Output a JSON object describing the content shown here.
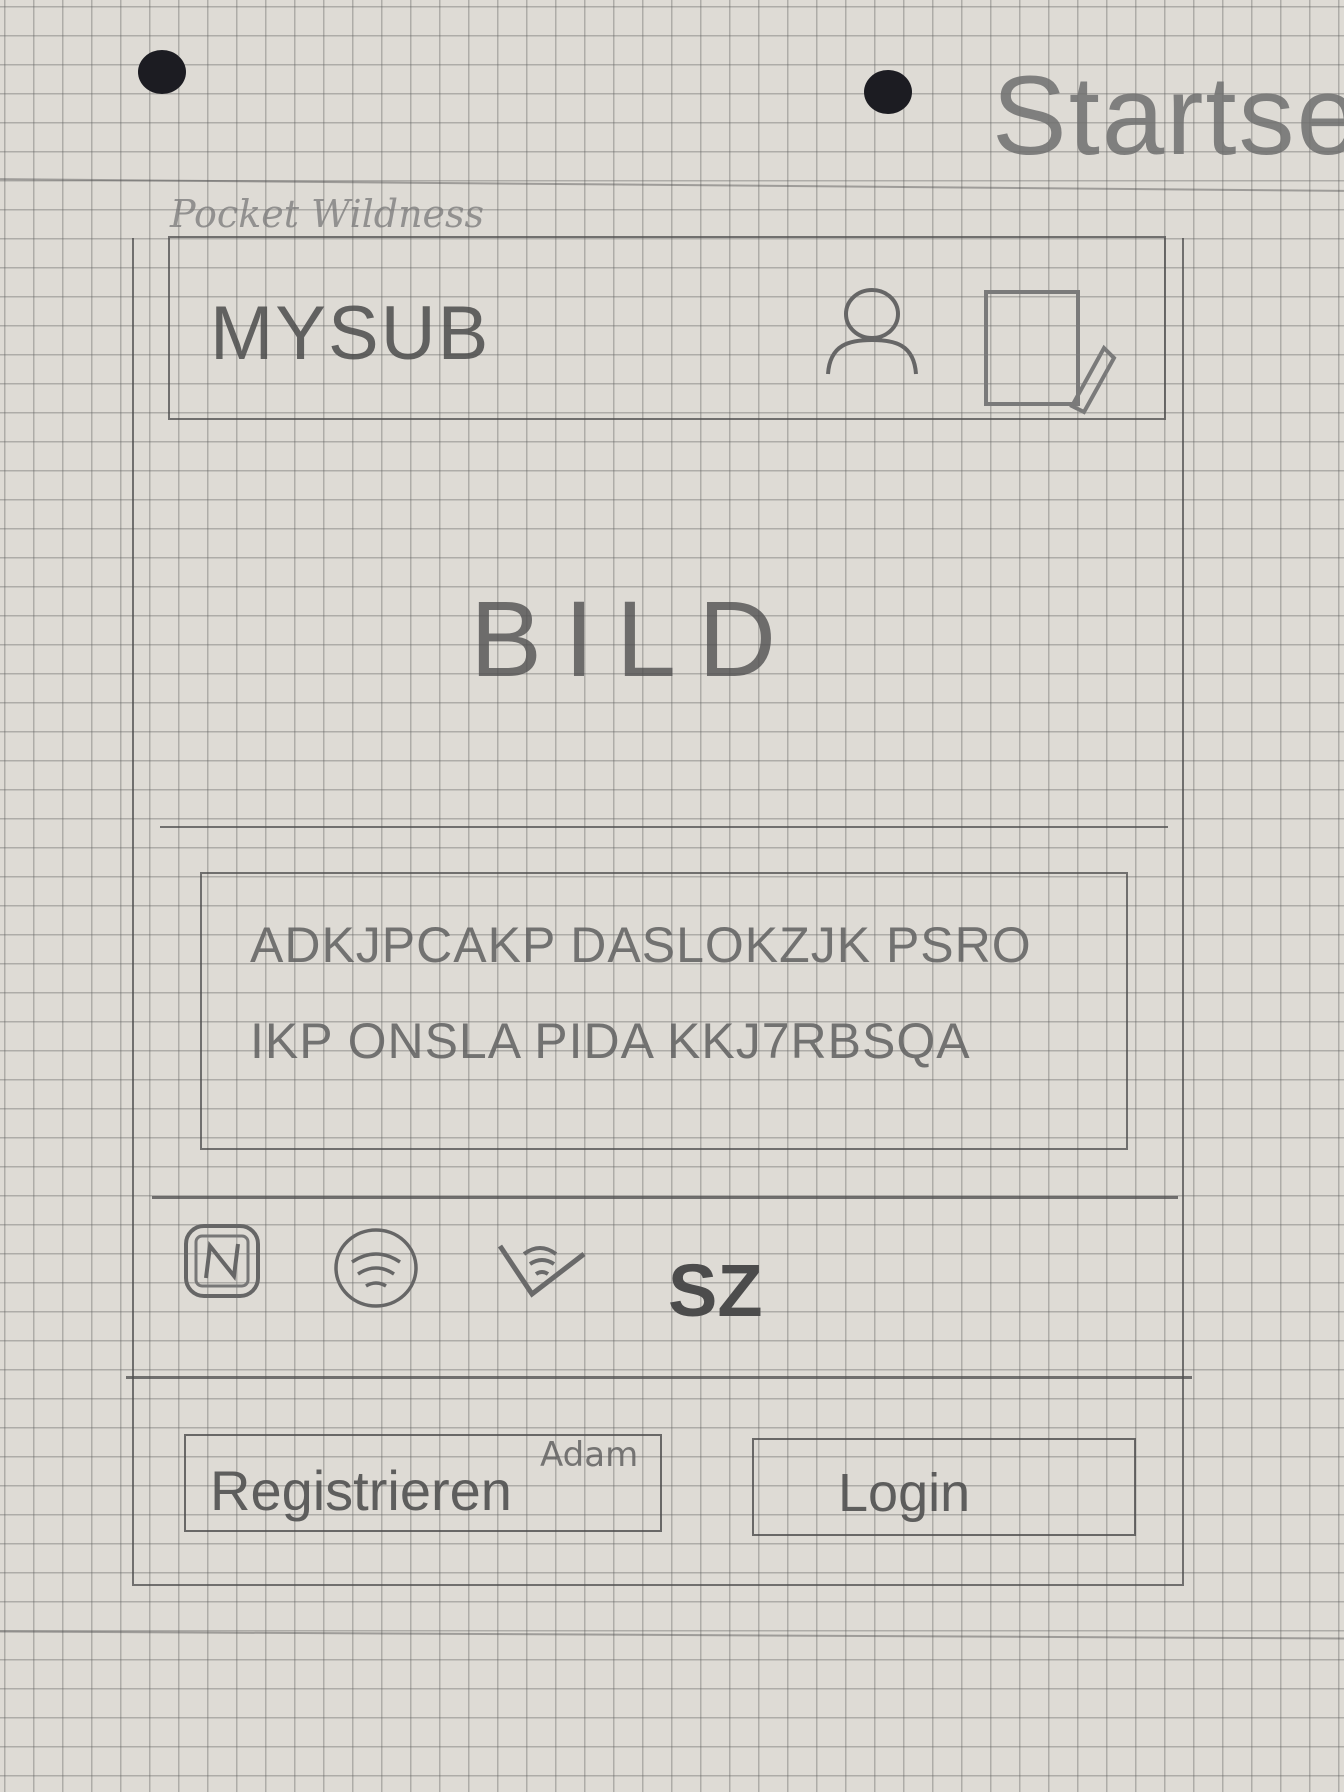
{
  "sheet": {
    "title": "Startse"
  },
  "app": {
    "name": "Pocket Wildness"
  },
  "header": {
    "title": "MYSUB",
    "profile_icon": "user-icon",
    "edit_icon": "edit-note-icon"
  },
  "hero": {
    "placeholder": "BILD"
  },
  "text_block": {
    "line1": "ADKJPCAKP DASLOKZJK PSRO",
    "line2": "IKP ONSLA PIDA KKJ7RBSQA"
  },
  "payment": {
    "icons": [
      "nfc-card-icon",
      "contactless-icon",
      "wireless-pay-icon"
    ],
    "label": "SZ"
  },
  "actions": {
    "register_label": "Registrieren",
    "login_label": "Login"
  },
  "annotation": {
    "author": "Adam"
  }
}
